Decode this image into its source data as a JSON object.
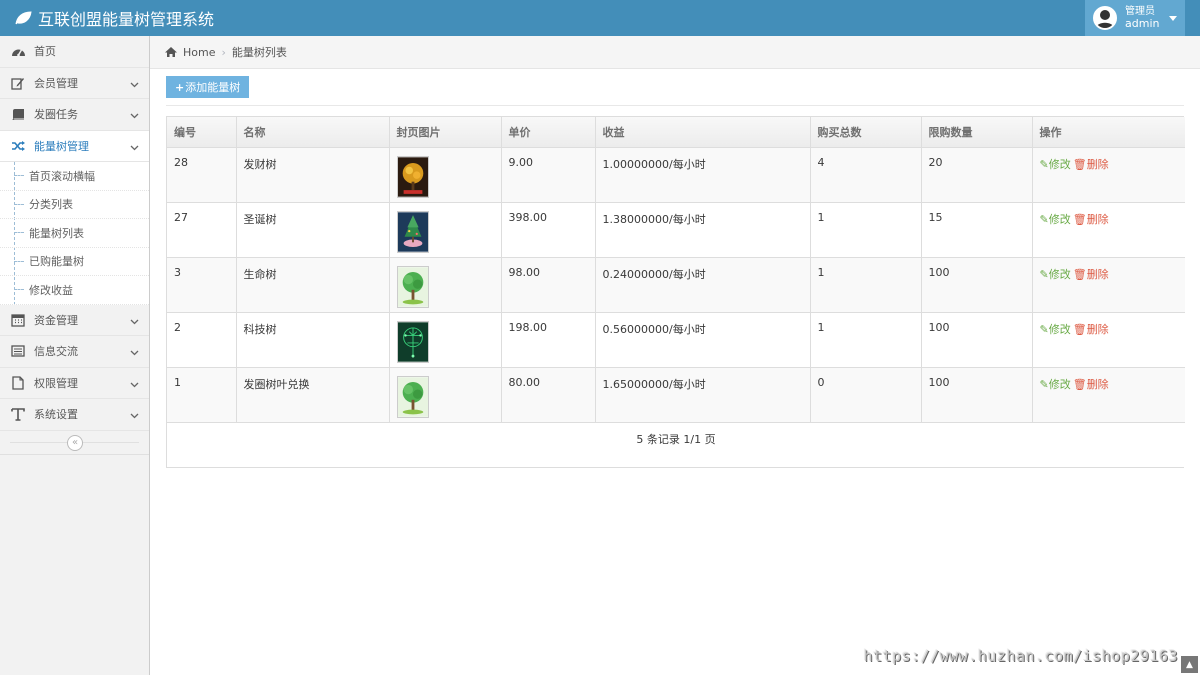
{
  "app": {
    "title": "互联创盟能量树管理系统"
  },
  "user": {
    "role": "管理员",
    "name": "admin"
  },
  "sidebar": {
    "items": [
      {
        "label": "首页",
        "icon": "dashboard-icon"
      },
      {
        "label": "会员管理",
        "icon": "edit-icon"
      },
      {
        "label": "发圈任务",
        "icon": "book-icon"
      },
      {
        "label": "能量树管理",
        "icon": "shuffle-icon",
        "active": true
      },
      {
        "label": "资金管理",
        "icon": "calendar-icon"
      },
      {
        "label": "信息交流",
        "icon": "list-alt-icon"
      },
      {
        "label": "权限管理",
        "icon": "file-icon"
      },
      {
        "label": "系统设置",
        "icon": "text-icon"
      }
    ],
    "submenu": [
      "首页滚动横幅",
      "分类列表",
      "能量树列表",
      "已购能量树",
      "修改收益"
    ]
  },
  "breadcrumb": {
    "home": "Home",
    "current": "能量树列表"
  },
  "toolbar": {
    "add_label": "添加能量树"
  },
  "table": {
    "headers": [
      "编号",
      "名称",
      "封页图片",
      "单价",
      "收益",
      "购买总数",
      "限购数量",
      "操作"
    ],
    "rows": [
      {
        "id": "28",
        "name": "发财树",
        "price": "9.00",
        "income": "1.00000000/每小时",
        "bought": "4",
        "limit": "20"
      },
      {
        "id": "27",
        "name": "圣诞树",
        "price": "398.00",
        "income": "1.38000000/每小时",
        "bought": "1",
        "limit": "15"
      },
      {
        "id": "3",
        "name": "生命树",
        "price": "98.00",
        "income": "0.24000000/每小时",
        "bought": "1",
        "limit": "100"
      },
      {
        "id": "2",
        "name": "科技树",
        "price": "198.00",
        "income": "0.56000000/每小时",
        "bought": "1",
        "limit": "100"
      },
      {
        "id": "1",
        "name": "发圈树叶兑换",
        "price": "80.00",
        "income": "1.65000000/每小时",
        "bought": "0",
        "limit": "100"
      }
    ],
    "edit_label": "修改",
    "delete_label": "删除",
    "pager": "5 条记录 1/1 页"
  },
  "watermark": "https://www.huzhan.com/ishop29163",
  "colors": {
    "navbar": "#438eb9",
    "user_box": "#62a8d1",
    "accent": "#2b7dbc",
    "add_button": "#6fb3e0",
    "edit": "#69aa46",
    "delete": "#dd5a43"
  }
}
